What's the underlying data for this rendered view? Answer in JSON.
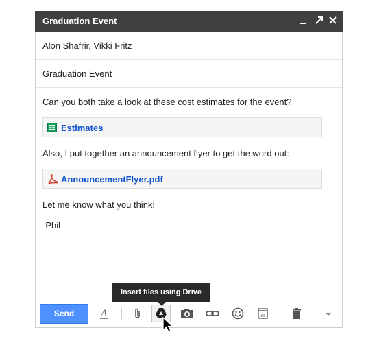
{
  "window": {
    "title": "Graduation Event",
    "controls": {
      "minimize": "minimize-icon",
      "popout": "popout-icon",
      "close": "close-icon"
    }
  },
  "recipients": "Alon Shafrir, Vikki Fritz",
  "subject": "Graduation Event",
  "body": {
    "line1": "Can you both take a look at these cost estimates for the event?",
    "attachment1": {
      "label": "Estimates",
      "icon": "spreadsheet-icon"
    },
    "line2": "Also, I put together an announcement flyer to get the word out:",
    "attachment2": {
      "label": "AnnouncementFlyer.pdf",
      "icon": "pdf-icon"
    },
    "line3": "Let me know what you think!",
    "signature": "-Phil"
  },
  "toolbar": {
    "send_label": "Send",
    "tooltip": "Insert files using Drive"
  },
  "colors": {
    "titlebar": "#404040",
    "send": "#4d90fe",
    "link": "#1155cc",
    "sheets": "#0f9d58",
    "pdf": "#d14836"
  }
}
